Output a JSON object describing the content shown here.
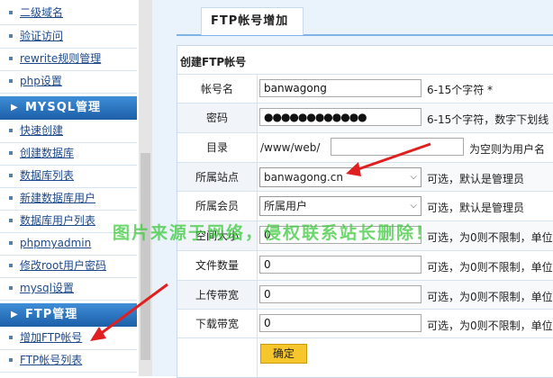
{
  "sidebar": {
    "top_links": [
      "二级域名",
      "验证访问",
      "rewrite规则管理",
      "php设置"
    ],
    "mysql_header": "MYSQL管理",
    "mysql_links": [
      "快速创建",
      "创建数据库",
      "数据库列表",
      "新建数据库用户",
      "数据库用户列表",
      "phpmyadmin",
      "修改root用户密码",
      "mysql设置"
    ],
    "ftp_header": "FTP管理",
    "ftp_links": [
      "增加FTP帐号",
      "FTP帐号列表"
    ]
  },
  "tab_title": "FTP帐号增加",
  "panel_title": "创建FTP帐号",
  "form": {
    "account": {
      "label": "帐号名",
      "value": "banwagong",
      "hint": "6-15个字符 *"
    },
    "password": {
      "label": "密码",
      "value": "●●●●●●●●●●●●",
      "hint": "6-15个字符，数字下划线"
    },
    "dir": {
      "label": "目录",
      "prefix": "/www/web/",
      "value": "",
      "hint": "为空则为用户名"
    },
    "site": {
      "label": "所属站点",
      "value": "banwagong.cn",
      "hint": "可选，默认是管理员"
    },
    "member": {
      "label": "所属会员",
      "value": "所属用户",
      "hint": "可选，默认是管理员"
    },
    "space": {
      "label": "空间大小",
      "value": "0",
      "hint": "可选，为0则不限制，单位"
    },
    "files": {
      "label": "文件数量",
      "value": "0",
      "hint": "可选，为0则不限制，单位"
    },
    "upload": {
      "label": "上传带宽",
      "value": "0",
      "hint": "可选，为0则不限制，单位"
    },
    "download": {
      "label": "下载带宽",
      "value": "0",
      "hint": "可选，为0则不限制，单位"
    },
    "submit": "确定"
  },
  "watermark": "图片来源于网络，侵权联系站长删除！",
  "colors": {
    "accent": "#1c5fa8",
    "submit": "#f6c62c",
    "arrow": "#e02020"
  }
}
